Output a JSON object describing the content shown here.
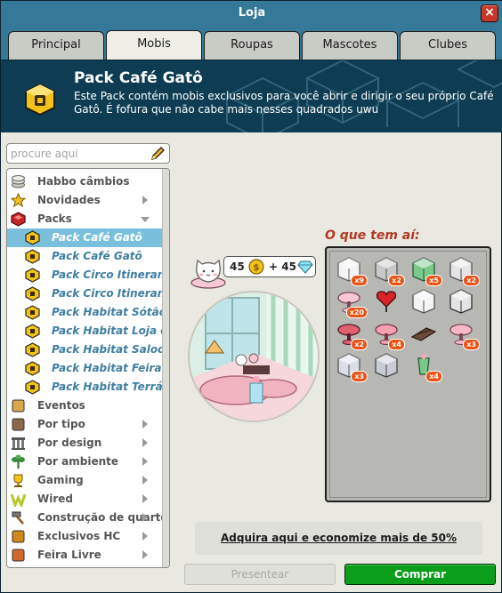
{
  "window": {
    "title": "Loja",
    "close_label": "×"
  },
  "tabs": [
    {
      "label": "Principal",
      "active": false
    },
    {
      "label": "Mobis",
      "active": true
    },
    {
      "label": "Roupas",
      "active": false
    },
    {
      "label": "Mascotes",
      "active": false
    },
    {
      "label": "Clubes",
      "active": false
    }
  ],
  "banner": {
    "title": "Pack Café Gatô",
    "description": "Este Pack contém mobis exclusivos para você abrir e dirigir o seu próprio Café Gatô. É fofura que não cabe mais nesses quadrados uwu"
  },
  "search": {
    "placeholder": "procure aqui"
  },
  "sidebar": {
    "items": [
      {
        "label": "Habbo câmbios",
        "icon": "coins-stack-icon",
        "level": 0
      },
      {
        "label": "Novidades",
        "icon": "star-icon",
        "level": 0,
        "expand": "right"
      },
      {
        "label": "Packs",
        "icon": "ruby-icon",
        "level": 0,
        "expand": "down"
      },
      {
        "label": "Pack Café Gatô",
        "icon": "pack-box-icon",
        "level": 1,
        "selected": true
      },
      {
        "label": "Pack Café Gatô",
        "icon": "pack-box-icon",
        "level": 1
      },
      {
        "label": "Pack Circo Itinerante",
        "icon": "pack-box-icon",
        "level": 1
      },
      {
        "label": "Pack Circo Itinerante",
        "icon": "pack-box-icon",
        "level": 1
      },
      {
        "label": "Pack Habitat Sótão do F",
        "icon": "pack-box-icon",
        "level": 1
      },
      {
        "label": "Pack Habitat Loja de Do",
        "icon": "pack-box-icon",
        "level": 1
      },
      {
        "label": "Pack Habitat Saloon do",
        "icon": "pack-box-icon",
        "level": 1
      },
      {
        "label": "Pack Habitat Feira do Lo",
        "icon": "pack-box-icon",
        "level": 1
      },
      {
        "label": "Pack Habitat Terrário do",
        "icon": "pack-box-icon",
        "level": 1
      },
      {
        "label": "Eventos",
        "icon": "event-cube-icon",
        "level": 0
      },
      {
        "label": "Por tipo",
        "icon": "box-icon",
        "level": 0,
        "expand": "right"
      },
      {
        "label": "Por design",
        "icon": "columns-icon",
        "level": 0,
        "expand": "right"
      },
      {
        "label": "Por ambiente",
        "icon": "plant-icon",
        "level": 0,
        "expand": "right"
      },
      {
        "label": "Gaming",
        "icon": "trophy-icon",
        "level": 0,
        "expand": "right"
      },
      {
        "label": "Wired",
        "icon": "wired-icon",
        "level": 0,
        "expand": "right"
      },
      {
        "label": "Construção de quartos",
        "icon": "hammer-icon",
        "level": 0,
        "expand": "right"
      },
      {
        "label": "Exclusivos HC",
        "icon": "hc-icon",
        "level": 0,
        "expand": "right"
      },
      {
        "label": "Feira Livre",
        "icon": "market-icon",
        "level": 0,
        "expand": "right"
      }
    ]
  },
  "preview": {
    "credits": "45",
    "diamonds": "+ 45"
  },
  "contents": {
    "title": "O que tem aí:",
    "items": [
      {
        "icon": "fridge-icon",
        "badge": "x9"
      },
      {
        "icon": "window-icon",
        "badge": "x2"
      },
      {
        "icon": "cat-bed-icon",
        "badge": "x5"
      },
      {
        "icon": "cat-tower-icon",
        "badge": "x2"
      },
      {
        "icon": "cake-stand-icon",
        "badge": "x20"
      },
      {
        "icon": "heart-lamp-icon",
        "badge": ""
      },
      {
        "icon": "counter-icon",
        "badge": ""
      },
      {
        "icon": "coffee-machine-icon",
        "badge": ""
      },
      {
        "icon": "stool-icon",
        "badge": "x2"
      },
      {
        "icon": "flower-table-icon",
        "badge": "x4"
      },
      {
        "icon": "plank-icon",
        "badge": ""
      },
      {
        "icon": "round-table-icon",
        "badge": "x3"
      },
      {
        "icon": "wall-shelf-icon",
        "badge": "x3"
      },
      {
        "icon": "menu-board-icon",
        "badge": ""
      },
      {
        "icon": "drink-icon",
        "badge": "x4"
      }
    ]
  },
  "footer": {
    "promo": "Adquira aqui e economize mais de 50%",
    "gift_label": "Presentear",
    "buy_label": "Comprar"
  },
  "colors": {
    "titlebar": "#367897",
    "banner": "#0e3d53",
    "selected_row": "#7ac0dd",
    "buy_button": "#0b9e1b",
    "contents_title": "#b13a26",
    "badge": "#ec5214"
  }
}
